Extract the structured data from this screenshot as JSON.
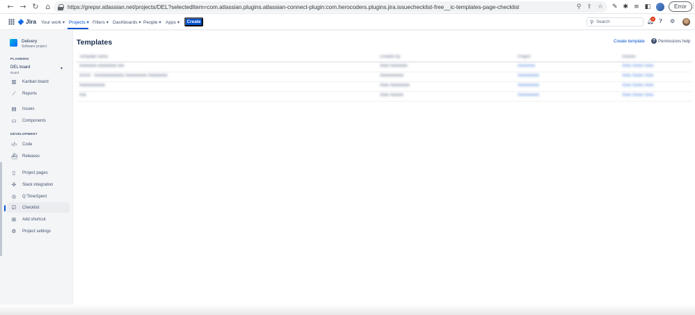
{
  "browser": {
    "url": "https://grepsr.atlassian.net/projects/DEL?selectedItem=com.atlassian.plugins.atlassian-connect-plugin:com.herocoders.plugins.jira.issuechecklist-free__ic-templates-page-checklist",
    "error_label": "Error"
  },
  "topnav": {
    "logo": "Jira",
    "items": [
      "Your work",
      "Projects",
      "Filters",
      "Dashboards",
      "People",
      "Apps"
    ],
    "create_label": "Create",
    "search_placeholder": "Search",
    "notification_count": "9"
  },
  "sidebar": {
    "project_name": "Delivery",
    "project_type": "Software project",
    "planning_header": "PLANNING",
    "board_name": "DEL board",
    "board_sub": "Board",
    "development_header": "DEVELOPMENT",
    "items": [
      {
        "label": "Kanban board",
        "icon": "kanban-icon"
      },
      {
        "label": "Reports",
        "icon": "reports-icon"
      },
      {
        "label": "Issues",
        "icon": "issues-icon"
      },
      {
        "label": "Components",
        "icon": "components-icon"
      },
      {
        "label": "Code",
        "icon": "code-icon"
      },
      {
        "label": "Releases",
        "icon": "releases-icon"
      },
      {
        "label": "Project pages",
        "icon": "pages-icon"
      },
      {
        "label": "Slack integration",
        "icon": "slack-icon"
      },
      {
        "label": "Q:TimeSpent",
        "icon": "timespent-icon"
      },
      {
        "label": "Checklist",
        "icon": "checklist-icon"
      },
      {
        "label": "Add shortcut",
        "icon": "add-shortcut-icon"
      },
      {
        "label": "Project settings",
        "icon": "settings-icon"
      }
    ]
  },
  "main": {
    "title": "Templates",
    "create_template": "Create template",
    "permissions_help": "Permissions help",
    "table": {
      "header": [
        "Template name",
        "Created by",
        "Project",
        "Actions"
      ],
      "rows": [
        [
          "Xxxxxxxx xxxxxxxxx xxx",
          "Xxxx Xxxxxxxx",
          "Xxxxxxxx",
          "Xxxx  Xxxxx  Xxxx"
        ],
        [
          "XXXX - Xxxxxxxxxxxxxx Xxxxxxxxxx Xxxxxxxxx",
          "Xxxxxxxxxxx",
          "Xxxxxxxxxx",
          "Xxxx  Xxxxx  Xxxx"
        ],
        [
          "Xxxxxxxxxxxx",
          "Xxxx Xxxxxxxxx",
          "Xxxxxxxxxx",
          "Xxxx  Xxxxx  Xxxx"
        ],
        [
          "Xxx",
          "Xxxx Xxxxxx",
          "Xxxxxxxxxx",
          "Xxxx  Xxxxx  Xxxx"
        ]
      ]
    }
  }
}
